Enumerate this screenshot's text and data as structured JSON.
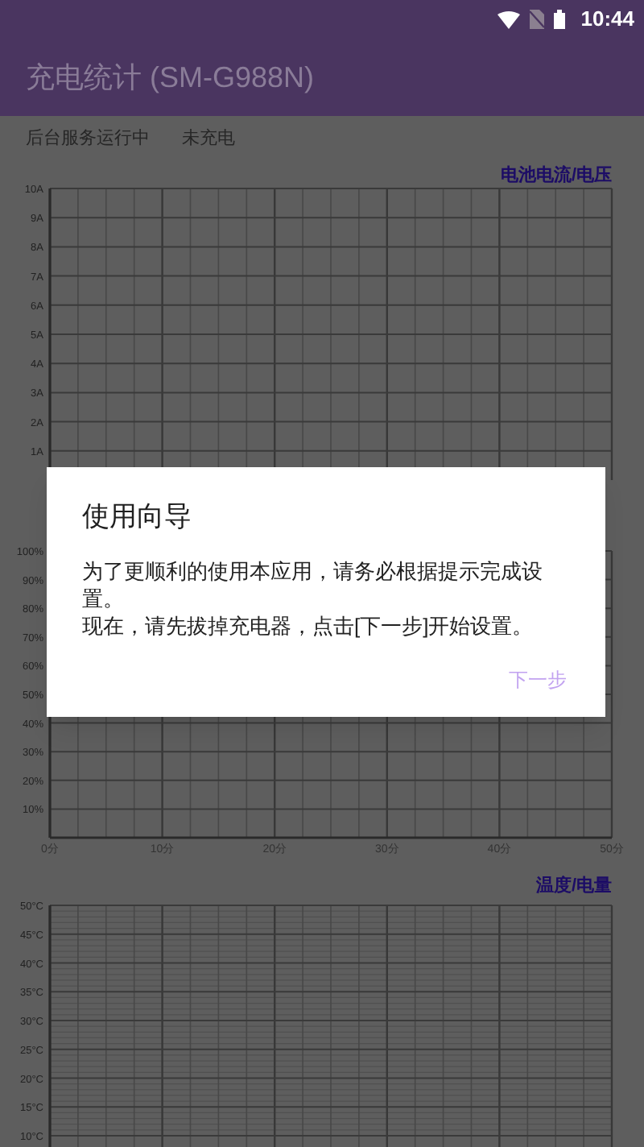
{
  "status_bar": {
    "time": "10:44"
  },
  "app_bar": {
    "title": "充电统计 (SM-G988N)"
  },
  "info": [
    "后台服务运行中",
    "未充电"
  ],
  "charts": [
    {
      "chart_data": {
        "type": "line",
        "grid": true,
        "categories": [
          null,
          null,
          null,
          null,
          null,
          null
        ],
        "title": "电池电流/电压",
        "ylim": [
          0,
          10
        ],
        "yticks": [
          {
            "value": 1,
            "label": "1A"
          },
          {
            "value": 2,
            "label": "2A"
          },
          {
            "value": 3,
            "label": "3A"
          },
          {
            "value": 4,
            "label": "4A"
          },
          {
            "value": 5,
            "label": "5A"
          },
          {
            "value": 6,
            "label": "6A"
          },
          {
            "value": 7,
            "label": "7A"
          },
          {
            "value": 8,
            "label": "8A"
          },
          {
            "value": 9,
            "label": "9A"
          },
          {
            "value": 10,
            "label": "10A"
          }
        ]
      }
    },
    {
      "chart_data": {
        "type": "line",
        "grid": true,
        "ylim": [
          0,
          100
        ],
        "xlim": [
          0,
          50
        ],
        "yticks": [
          {
            "value": 10,
            "label": "10%"
          },
          {
            "value": 20,
            "label": "20%"
          },
          {
            "value": 30,
            "label": "30%"
          },
          {
            "value": 40,
            "label": "40%"
          },
          {
            "value": 50,
            "label": "50%"
          },
          {
            "value": 60,
            "label": "60%"
          },
          {
            "value": 70,
            "label": "70%"
          },
          {
            "value": 80,
            "label": "80%"
          },
          {
            "value": 90,
            "label": "90%"
          },
          {
            "value": 100,
            "label": "100%"
          }
        ],
        "xticks": [
          {
            "value": 0,
            "label": "0分"
          },
          {
            "value": 10,
            "label": "10分"
          },
          {
            "value": 20,
            "label": "20分"
          },
          {
            "value": 30,
            "label": "30分"
          },
          {
            "value": 40,
            "label": "40分"
          },
          {
            "value": 50,
            "label": "50分"
          }
        ]
      }
    },
    {
      "chart_data": {
        "type": "line",
        "grid": true,
        "categories": [
          null,
          null,
          null,
          null,
          null,
          null
        ],
        "title": "温度/电量",
        "ylim": [
          10,
          50
        ],
        "yticks": [
          {
            "value": 10,
            "label": "10°C"
          },
          {
            "value": 15,
            "label": "15°C"
          },
          {
            "value": 20,
            "label": "20°C"
          },
          {
            "value": 25,
            "label": "25°C"
          },
          {
            "value": 30,
            "label": "30°C"
          },
          {
            "value": 35,
            "label": "35°C"
          },
          {
            "value": 40,
            "label": "40°C"
          },
          {
            "value": 45,
            "label": "45°C"
          },
          {
            "value": 50,
            "label": "50°C"
          }
        ]
      }
    }
  ],
  "dialog": {
    "title": "使用向导",
    "message_lines": [
      "为了更顺利的使用本应用，请务必根据提示完成设置。",
      "现在，请先拔掉充电器，点击[下一步]开始设置。"
    ],
    "button": "下一步"
  }
}
